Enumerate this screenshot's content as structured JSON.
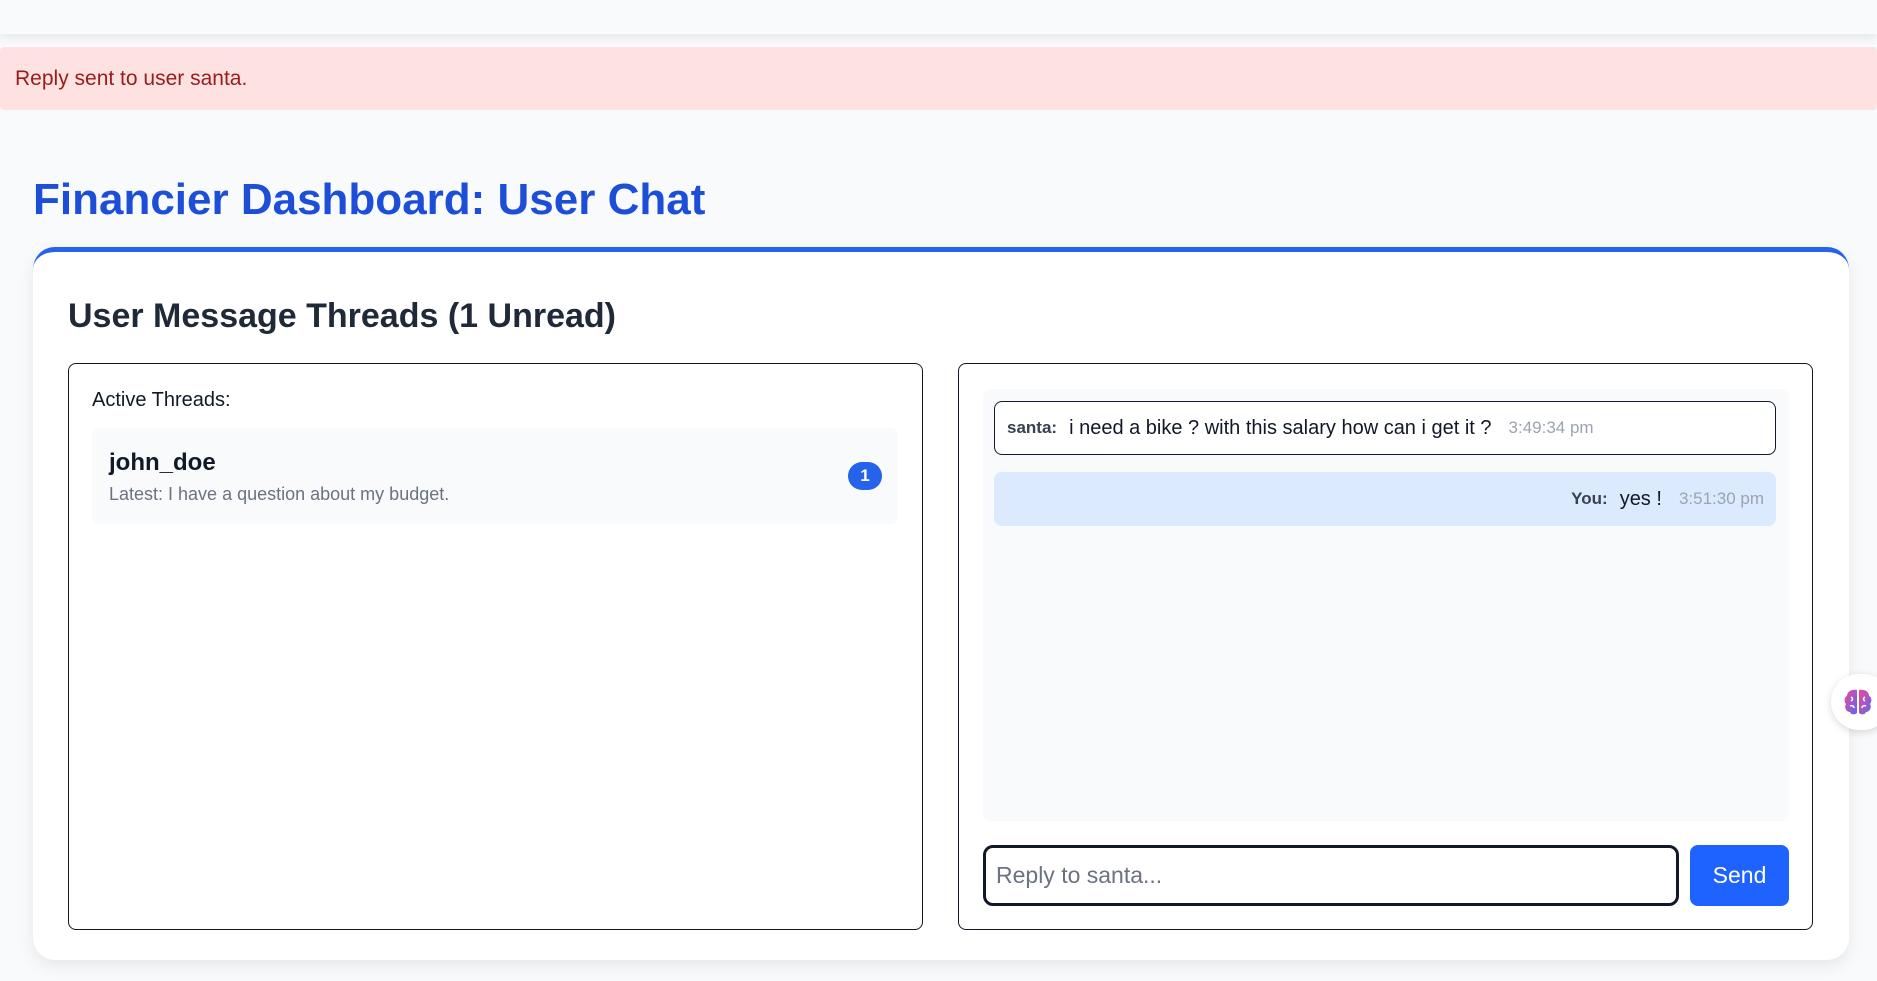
{
  "flash": {
    "message": "Reply sent to user santa."
  },
  "page": {
    "title": "Financier Dashboard: User Chat"
  },
  "threads_card": {
    "title": "User Message Threads (1 Unread)",
    "active_label": "Active Threads:",
    "threads": [
      {
        "name": "john_doe",
        "latest": "Latest: I have a question about my budget.",
        "unread": "1"
      }
    ]
  },
  "chat": {
    "messages": [
      {
        "sender": "santa:",
        "text": "i need a bike ? with this salary how can i get it ?",
        "time": "3:49:34 pm"
      },
      {
        "sender": "You:",
        "text": "yes !",
        "time": "3:51:30 pm"
      }
    ],
    "input_placeholder": "Reply to santa...",
    "input_value": "",
    "send_label": "Send"
  },
  "colors": {
    "accent": "#2563eb",
    "title": "#1d4ed8",
    "flash_bg": "#fee2e2",
    "flash_text": "#991b1b",
    "outgoing_bubble": "#dbeafe"
  },
  "icons": {
    "assistant": "brain-icon"
  }
}
